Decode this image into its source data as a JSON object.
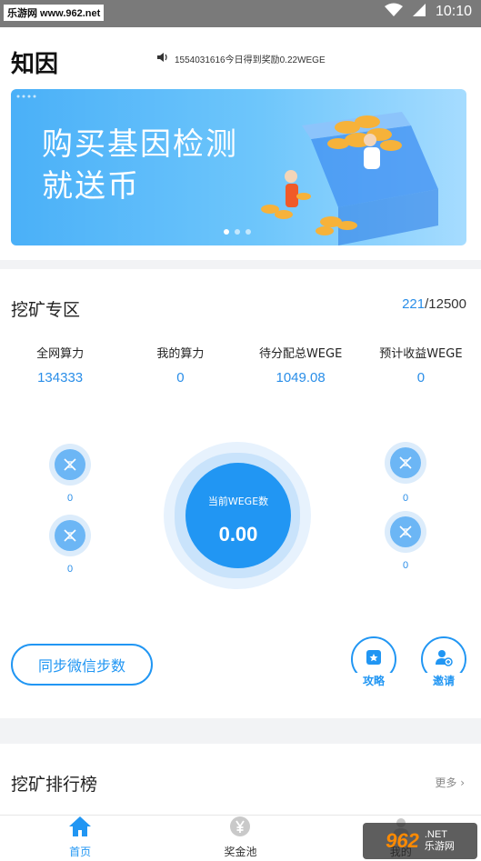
{
  "status_bar": {
    "time": "10:10",
    "watermark": "乐游网 www.962.net"
  },
  "header": {
    "app_title": "知因",
    "notice": "1554031616今日得到奖励0.22WEGE",
    "banner_text_line1": "购买基因检测",
    "banner_text_line2": "就送币",
    "banner_dots": 3,
    "banner_active_dot": 0
  },
  "mining": {
    "title": "挖矿专区",
    "count_current": "221",
    "count_total": "/12500",
    "stats": [
      {
        "label": "全网算力",
        "value": "134333"
      },
      {
        "label": "我的算力",
        "value": "0"
      },
      {
        "label": "待分配总WEGE",
        "value": "1049.08"
      },
      {
        "label": "预计收益WEGE",
        "value": "0"
      }
    ],
    "bubbles": [
      "0",
      "0",
      "0",
      "0"
    ],
    "core_label": "当前WEGE数",
    "core_value": "0.00",
    "sync_button": "同步微信步数",
    "guide_label": "攻略",
    "invite_label": "邀请"
  },
  "ranking": {
    "title": "挖矿排行榜",
    "more": "更多 ›"
  },
  "tabbar": {
    "tabs": [
      "首页",
      "奖金池",
      "我的"
    ]
  },
  "watermark_bottom": {
    "number": "962",
    "text_line1": ".NET",
    "text_line2": "乐游网"
  },
  "colors": {
    "accent": "#2196f3",
    "value_blue": "#2a8ee8"
  }
}
